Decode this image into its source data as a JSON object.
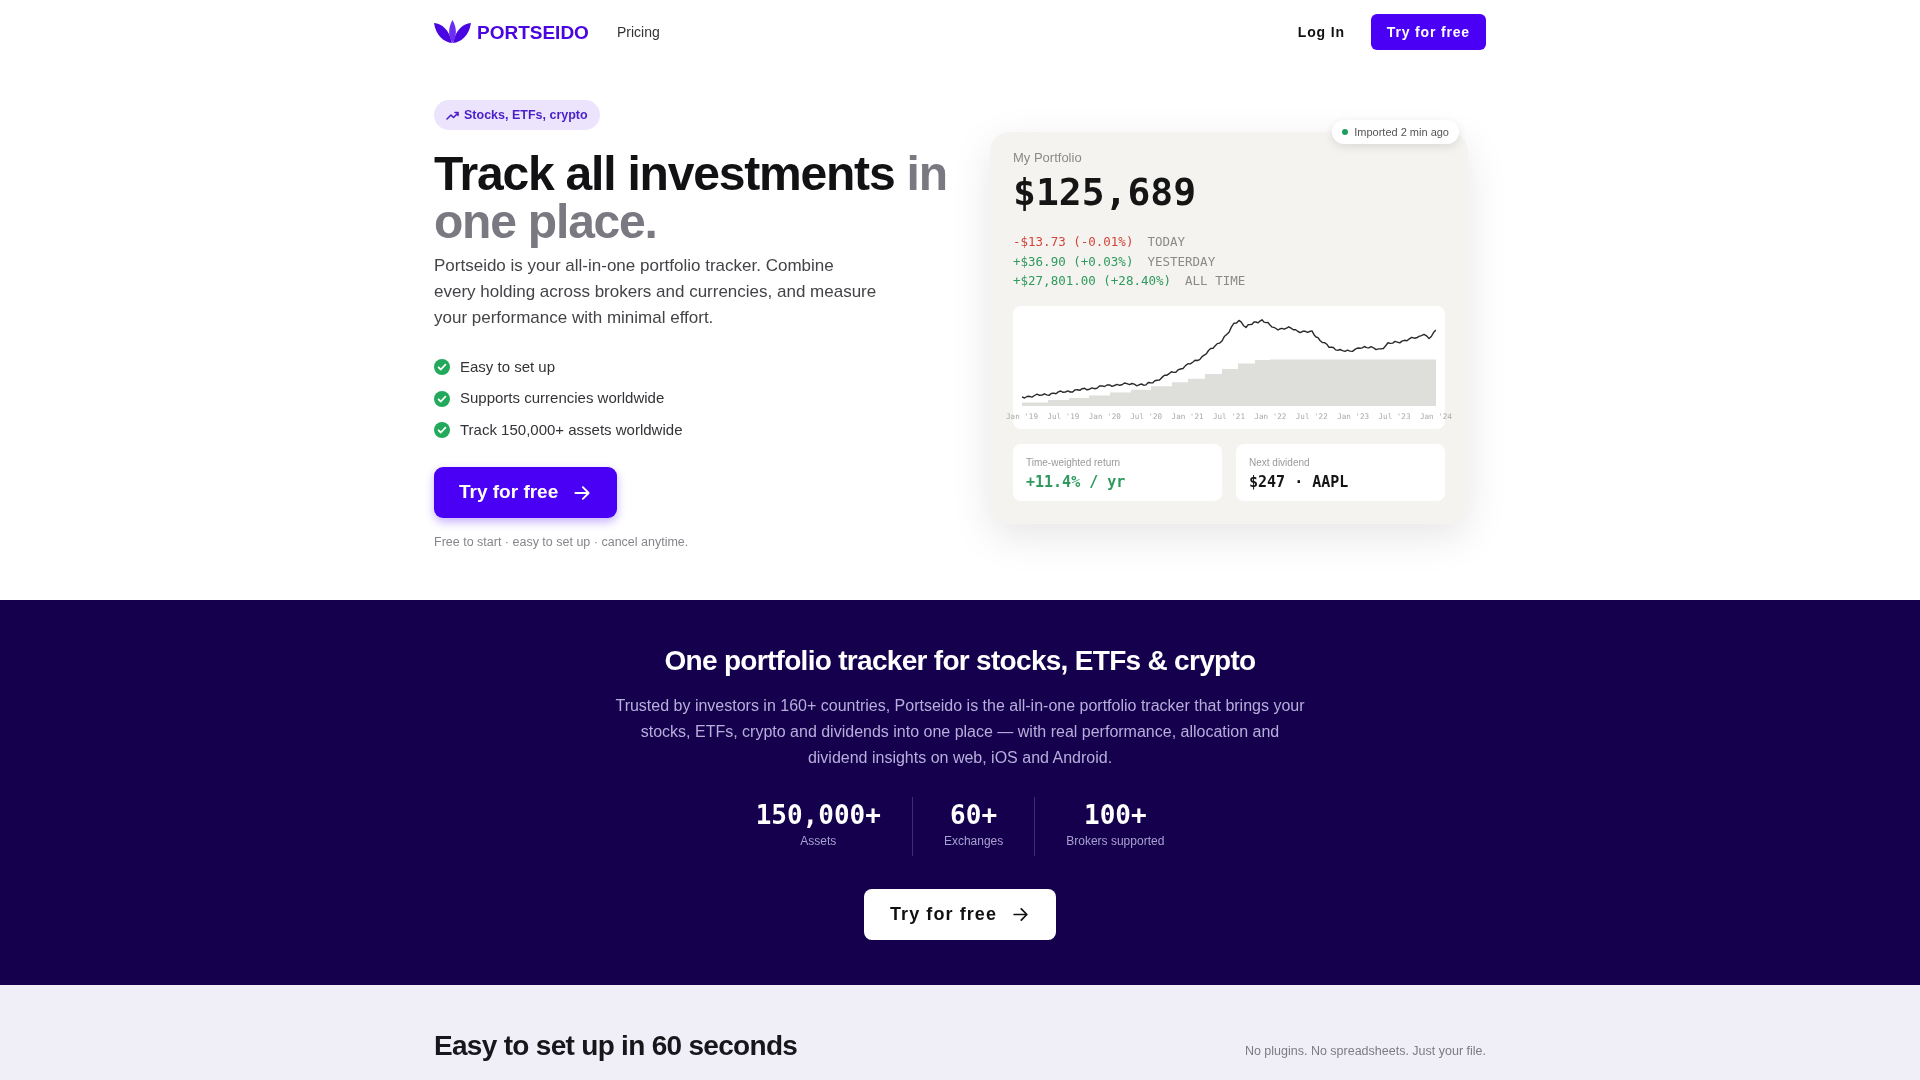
{
  "header": {
    "logo_text": "PORTSEIDO",
    "nav": [
      {
        "label": "Pricing"
      }
    ],
    "login": "Log In",
    "cta": "Try for free"
  },
  "hero": {
    "badge": "Stocks, ETFs, crypto",
    "headline": [
      {
        "text": "Track all investments",
        "muted": false
      },
      {
        "text": "in one place.",
        "muted": true
      }
    ],
    "description": "Portseido is your all-in-one portfolio tracker. Combine every holding across brokers and currencies, and measure your performance with minimal effort.",
    "features": [
      "Easy to set up",
      "Supports currencies worldwide",
      "Track 150,000+ assets worldwide"
    ],
    "cta": "Try for free",
    "footnote": "Free to start · easy to set up · cancel anytime."
  },
  "portfolio_card": {
    "status": "Imported 2 min ago",
    "title": "My Portfolio",
    "value": "$125,689",
    "changes": [
      {
        "amount": "-$13.73 (-0.01%)",
        "period": "TODAY",
        "color": "#d0453b"
      },
      {
        "amount": "+$36.90 (+0.03%)",
        "period": "YESTERDAY",
        "color": "#2e9a5e"
      },
      {
        "amount": "+$27,801.00 (+28.40%)",
        "period": "ALL TIME",
        "color": "#2e9a5e"
      }
    ],
    "chart": {
      "axis_labels": [
        "Jan '19",
        "Jul '19",
        "Jan '20",
        "Jul '20",
        "Jan '21",
        "Jul '21",
        "Jan '22",
        "Jul '22",
        "Jan '23",
        "Jul '23",
        "Jan '24"
      ]
    },
    "stats": [
      {
        "label": "Time-weighted return",
        "value": "+11.4% / yr",
        "color": "#2e9a5e"
      },
      {
        "label": "Next dividend",
        "value": "$247 · AAPL",
        "color": "#151515"
      }
    ]
  },
  "highlights": {
    "title": "One portfolio tracker for stocks, ETFs & crypto",
    "description": "Trusted by investors in 160+ countries, Portseido is the all-in-one portfolio tracker that brings your stocks, ETFs, crypto and dividends into one place — with real performance, allocation and dividend insights on web, iOS and Android.",
    "stats": [
      {
        "value": "150,000+",
        "label": "Assets"
      },
      {
        "value": "60+",
        "label": "Exchanges"
      },
      {
        "value": "100+",
        "label": "Brokers supported"
      }
    ],
    "cta": "Try for free"
  },
  "setup": {
    "title": "Easy to set up in 60 seconds",
    "note": "No plugins. No spreadsheets. Just your file."
  }
}
